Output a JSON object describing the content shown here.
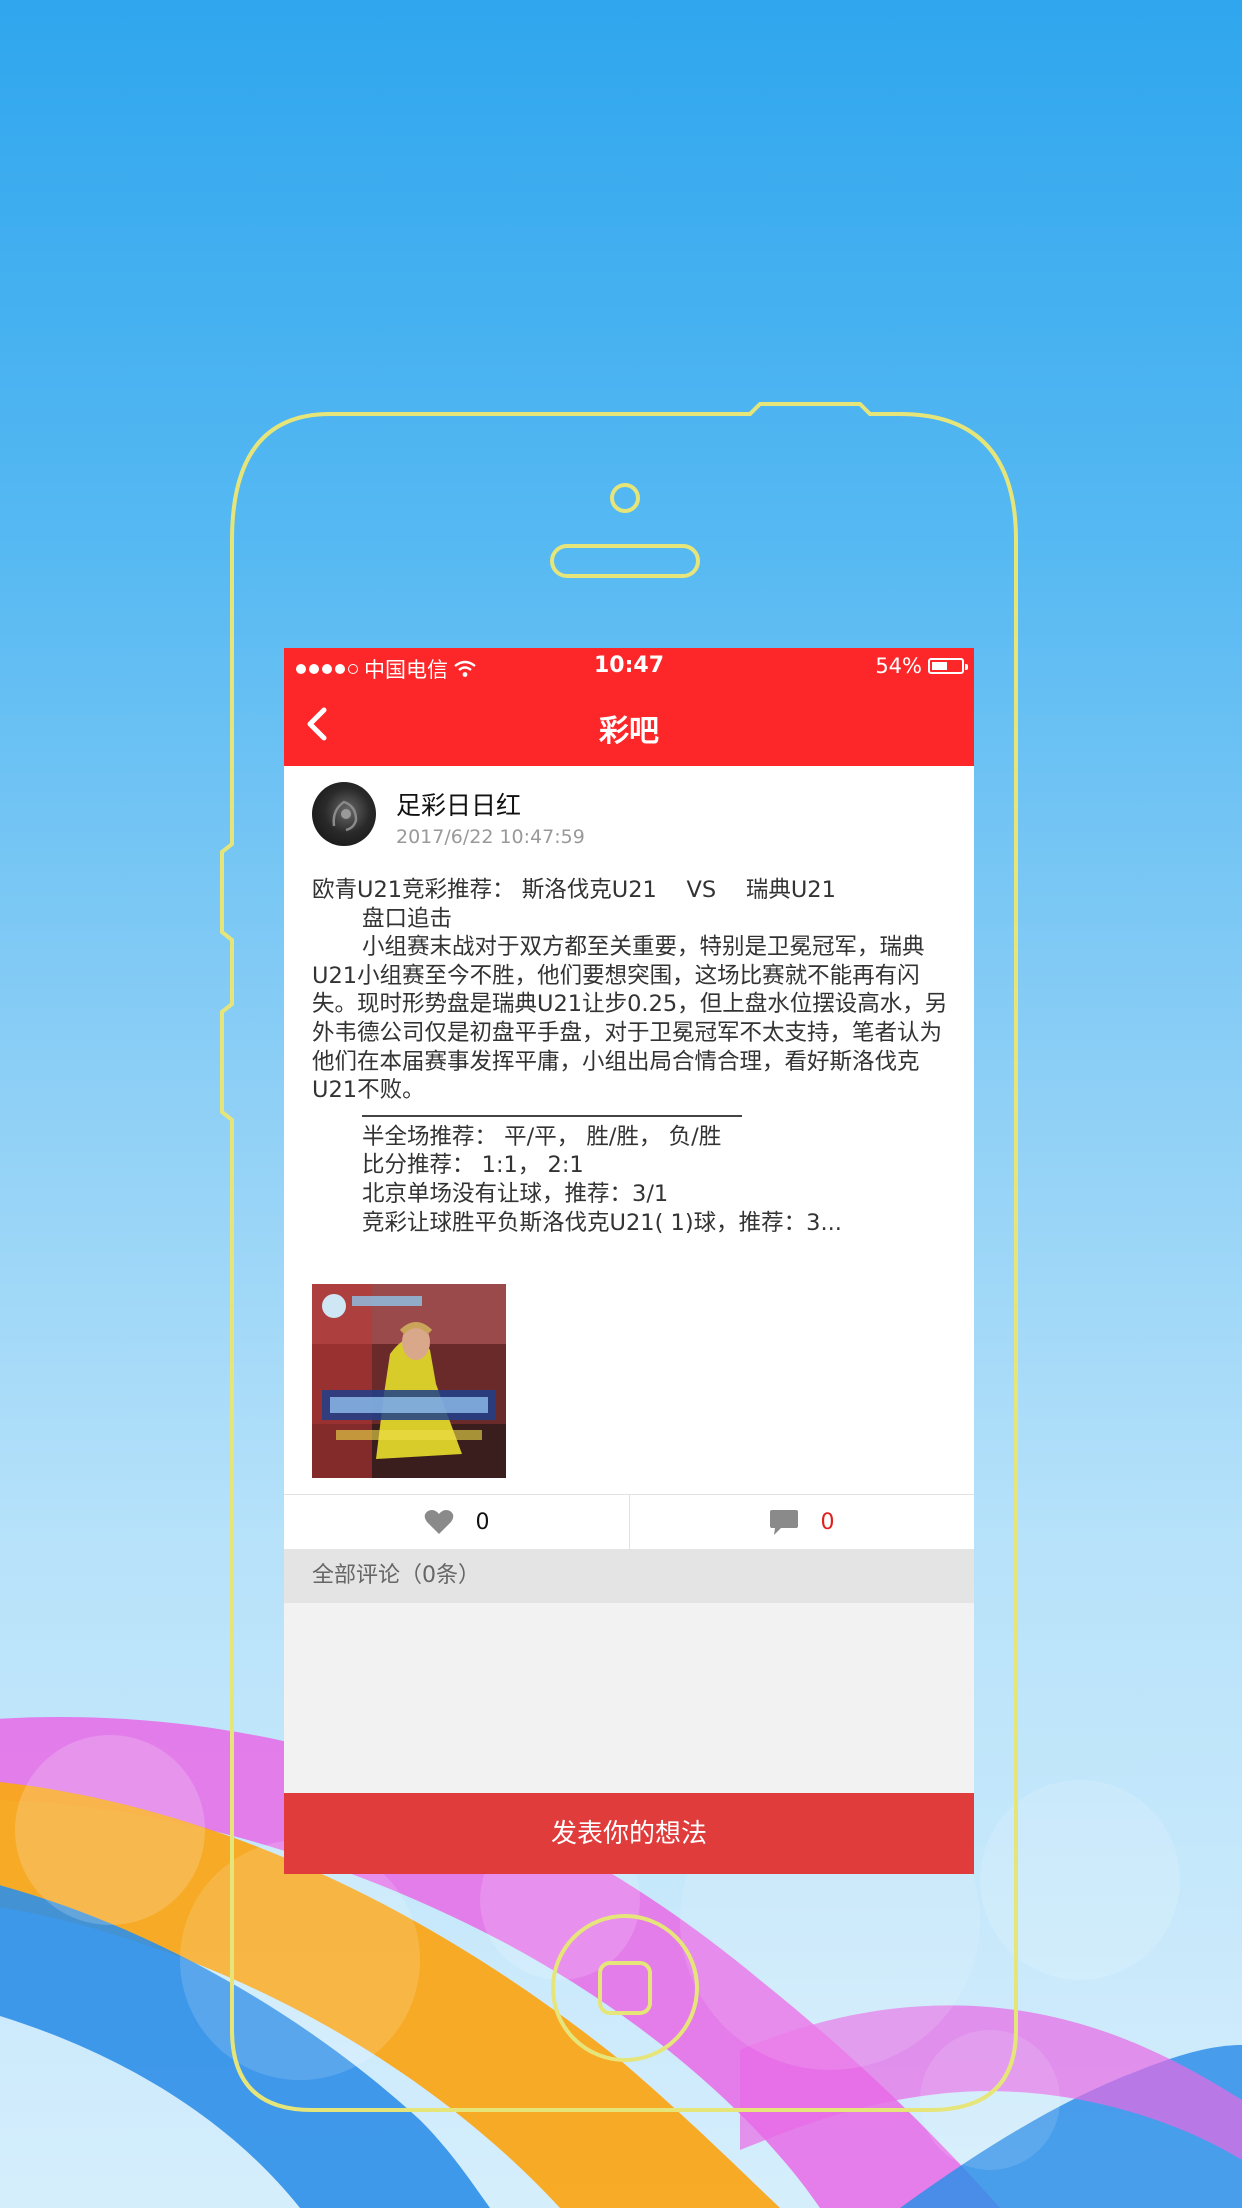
{
  "status_bar": {
    "carrier": "中国电信",
    "time": "10:47",
    "battery_percent": "54%",
    "battery_level": 0.54
  },
  "nav": {
    "title": "彩吧"
  },
  "post": {
    "author": "足彩日日红",
    "timestamp": "2017/6/22 10:47:59",
    "lines": [
      "欧青U21竞彩推荐： 斯洛伐克U21　 VS　 瑞典U21",
      "盘口追击",
      "小组赛末战对于双方都至关重要，特别是卫冕冠军，瑞典U21小组赛至今不胜，他们要想突围，这场比赛就不能再有闪失。现时形势盘是瑞典U21让步0.25，但上盘水位摆设高水，另外韦德公司仅是初盘平手盘，对于卫冕冠军不太支持，笔者认为他们在本届赛事发挥平庸，小组出局合情合理，看好斯洛伐克U21不败。",
      "半全场推荐：  平/平，  胜/胜，  负/胜",
      "比分推荐：  1:1，  2:1",
      "北京单场没有让球，推荐：3/1",
      "竞彩让球胜平负斯洛伐克U21( 1)球，推荐：3..."
    ]
  },
  "actions": {
    "like_count": "0",
    "comment_count": "0"
  },
  "comments": {
    "header": "全部评论（0条）"
  },
  "footer": {
    "post_button_label": "发表你的想法"
  },
  "colors": {
    "accent_red": "#fd2729",
    "button_red": "#e03c3c",
    "background_blue": "#2fa6ee"
  }
}
